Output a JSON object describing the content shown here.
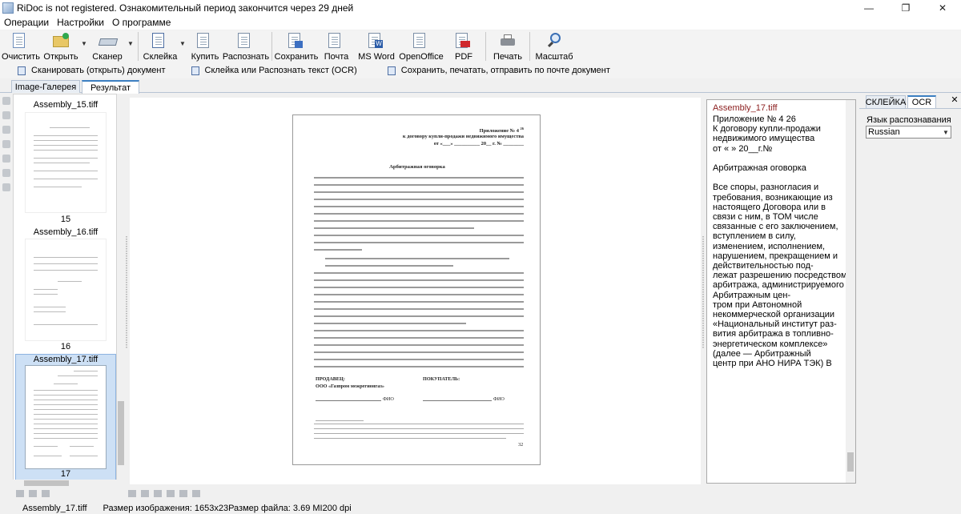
{
  "window": {
    "title": "RiDoc is not registered. Ознакомительный период закончится через 29 дней"
  },
  "menu": [
    "Операции",
    "Настройки",
    "О программе"
  ],
  "toolbar": {
    "clear": "Очистить",
    "open": "Открыть",
    "scanner": "Сканер",
    "glue": "Склейка",
    "buy": "Купить",
    "recognize": "Распознать",
    "save": "Сохранить",
    "mail": "Почта",
    "msword": "MS Word",
    "openoffice": "OpenOffice",
    "pdf": "PDF",
    "print": "Печать",
    "zoom": "Масштаб"
  },
  "quick": {
    "scan": "Сканировать (открыть) документ",
    "glue": "Склейка или Распознать текст (OCR)",
    "save": "Сохранить, печатать, отправить по почте документ"
  },
  "tabs": {
    "gallery": "Image-Галерея",
    "result": "Результат"
  },
  "thumbs": [
    {
      "file": "Assembly_15.tiff",
      "num": "15"
    },
    {
      "file": "Assembly_16.tiff",
      "num": "16"
    },
    {
      "file": "Assembly_17.tiff",
      "num": "17"
    }
  ],
  "page": {
    "header1": "Приложение № 4",
    "header_sup": "26",
    "header2": "к договору купли-продажи недвижимого имущества",
    "header3": "от «___» __________ 20__ г. № ________",
    "title": "Арбитражная оговорка",
    "seller_label": "ПРОДАВЕЦ:",
    "seller_name": "ООО «Газпром межрегионгаз»",
    "buyer_label": "ПОКУПАТЕЛЬ:",
    "fio1": "ФИО",
    "fio2": "ФИО",
    "page_num": "32"
  },
  "ocr": {
    "filename": "Assembly_17.tiff",
    "lines": [
      "Приложение № 4 26",
      "К договору купли-продажи недвижимого имущества",
      "от « » 20__г.№",
      "",
      "Арбитражная оговорка",
      "",
      "Все споры, разногласия и требования, возникающие из настоящего Договора или в связи с ним, в ТОМ числе связанные с его заключением, вступлением в силу,",
      "изменением, исполнением, нарушением, прекращением и действительностью под-",
      "лежат разрешению посредством арбитража, администрируемого Арбитражным цен-",
      "тром при Автономной некоммерческой организации «Национальный институт раз-",
      "вития арбитража в топливно-энергетическом комплексе» (далее — Арбитражный",
      "центр при АНО НИРА ТЭК) В"
    ]
  },
  "right": {
    "tab_glue": "СКЛЕЙКА",
    "tab_ocr": "OCR",
    "lang_label": "Язык распознавания",
    "lang_value": "Russian"
  },
  "status": {
    "file": "Assembly_17.tiff",
    "imgsize": "Размер изображения: 1653x23",
    "filesize": "Размер файла: 3.69 МІ200 dpi"
  }
}
